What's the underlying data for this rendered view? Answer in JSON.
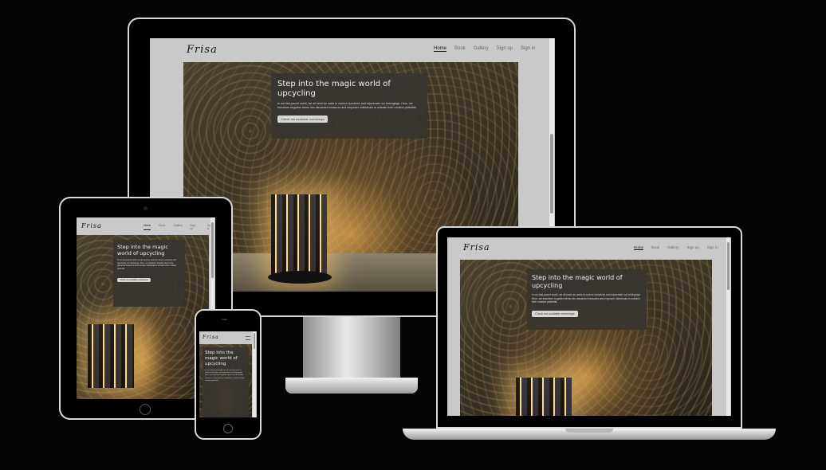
{
  "site": {
    "logo": "Frisa",
    "nav": [
      "Home",
      "Book",
      "Gallery",
      "Sign up",
      "Sign in"
    ],
    "hero_title": "Step into the magic world of upcycling",
    "hero_text": "In our fast-paced world, we all need an oasis to nurture ourselves and rejuvenate our belongings. Here, we transform forgotten items into discarded treasures and empower individuals to unleash their creative potential.",
    "hero_button": "Check out available workshops"
  },
  "phone": {
    "status": "Frisa"
  },
  "colors": {
    "background": "#050505",
    "card": "#37342f",
    "nav_bar": "#c9c9c9"
  }
}
